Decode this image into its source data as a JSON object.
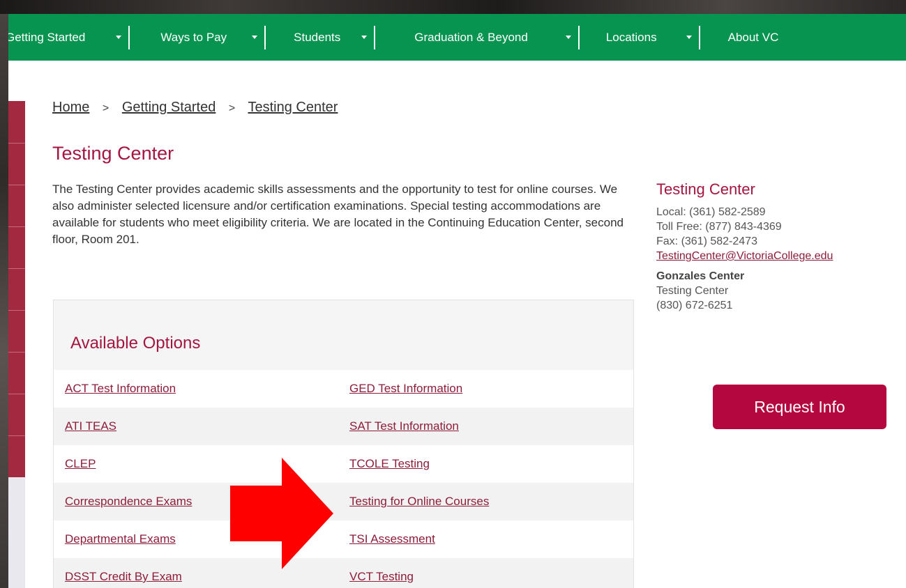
{
  "nav": {
    "items": [
      {
        "label": "Getting Started"
      },
      {
        "label": "Ways to Pay"
      },
      {
        "label": "Students"
      },
      {
        "label": "Graduation & Beyond"
      },
      {
        "label": "Locations"
      },
      {
        "label": "About VC"
      }
    ]
  },
  "breadcrumb": [
    "Home",
    "Getting Started",
    "Testing Center"
  ],
  "breadcrumb_separator": ">",
  "page": {
    "title": "Testing Center",
    "intro": "The Testing Center provides academic skills assessments and the opportunity to test for online courses. We also administer selected licensure and/or certification examinations. Special testing accommodations are available for students who meet eligibility criteria. We are located in the Continuing Education Center, second floor, Room 201."
  },
  "options": {
    "heading": "Available Options",
    "rows": [
      [
        "ACT Test Information",
        "GED Test Information"
      ],
      [
        "ATI TEAS",
        "SAT Test Information"
      ],
      [
        "CLEP",
        "TCOLE Testing"
      ],
      [
        "Correspondence Exams",
        "Testing for Online Courses"
      ],
      [
        "Departmental Exams",
        "TSI Assessment"
      ],
      [
        "DSST Credit By Exam",
        "VCT Testing"
      ]
    ]
  },
  "contact": {
    "title": "Testing Center",
    "local": "Local: (361) 582-2589",
    "toll_free": "Toll Free: (877) 843-4369",
    "fax": "Fax:  (361) 582-2473",
    "email": "TestingCenter@VictoriaCollege.edu",
    "gonzales_title": "Gonzales Center",
    "gonzales_sub": "Testing Center",
    "gonzales_phone": "(830) 672-6251"
  },
  "request_button": "Request Info",
  "colors": {
    "nav_green": "#079451",
    "brand_maroon": "#a4163f",
    "button": "#b5073f",
    "annotation_arrow": "#ff0000"
  },
  "icons": [
    "chevron-down-icon",
    "red-arrow-annotation-icon"
  ]
}
